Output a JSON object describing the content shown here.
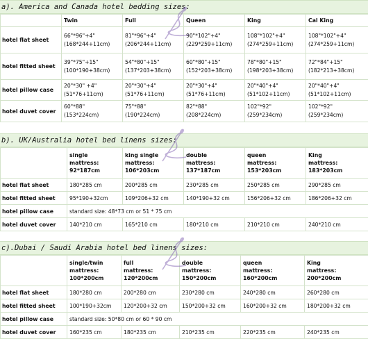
{
  "sections": [
    {
      "title": "a). America and Canada hotel bedding sizes:",
      "columns": [
        "",
        "Twin",
        "Full",
        "Queen",
        "King",
        "Cal King"
      ],
      "rows": [
        {
          "label": "hotel flat sheet",
          "cells": [
            {
              "l1": "66\"*96\"+4\"",
              "l2": "(168*244+11cm)"
            },
            {
              "l1": "81\"*96\"+4\"",
              "l2": "(206*244+11cm)"
            },
            {
              "l1": "90\"*102\"+4\"",
              "l2": "(229*259+11cm)"
            },
            {
              "l1": "108\"*102\"+4\"",
              "l2": "(274*259+11cm)"
            },
            {
              "l1": "108\"*102\"+4\"",
              "l2": "(274*259+11cm)"
            }
          ]
        },
        {
          "label": "hotel fitted sheet",
          "cells": [
            {
              "l1": "39\"*75\"+15\"",
              "l2": "(100*190+38cm)"
            },
            {
              "l1": "54\"*80\"+15\"",
              "l2": "(137*203+38cm)"
            },
            {
              "l1": "60\"*80\"+15\"",
              "l2": "(152*203+38cm)"
            },
            {
              "l1": "78\"*80\"+15\"",
              "l2": "(198*203+38cm)"
            },
            {
              "l1": "72\"*84\"+15\"",
              "l2": "(182*213+38cm)"
            }
          ]
        },
        {
          "label": "hotel pillow case",
          "cells": [
            {
              "l1": "20\"*30\" +4\"",
              "l2": "(51*76+11cm)"
            },
            {
              "l1": "20\"*30\"+4\"",
              "l2": "(51*76+11cm)"
            },
            {
              "l1": "20\"*30\"+4\"",
              "l2": "(51*76+11cm)"
            },
            {
              "l1": "20\"*40\"+4\"",
              "l2": "(51*102+11cm)"
            },
            {
              "l1": "20\"*40\"+4\"",
              "l2": "(51*102+11cm)"
            }
          ]
        },
        {
          "label": "hotel duvet cover",
          "cells": [
            {
              "l1": "60\"*88\"",
              "l2": "(153*224cm)"
            },
            {
              "l1": "75\"*88\"",
              "l2": "(190*224cm)"
            },
            {
              "l1": "82\"*88\"",
              "l2": "(208*224cm)"
            },
            {
              "l1": "102\"*92\"",
              "l2": "(259*234cm)"
            },
            {
              "l1": "102\"*92\"",
              "l2": "(259*234cm)"
            }
          ]
        }
      ]
    },
    {
      "title": "b). UK/Australia hotel bed linens sizes:",
      "columns": [
        {
          "a": "",
          "b": "",
          "c": ""
        },
        {
          "a": "single",
          "b": "mattress:",
          "c": "92*187cm"
        },
        {
          "a": "king single",
          "b": "mattress:",
          "c": "106*203cm"
        },
        {
          "a": "double",
          "b": "mattress:",
          "c": "137*187cm"
        },
        {
          "a": "queen",
          "b": "mattress:",
          "c": "153*203cm"
        },
        {
          "a": "King",
          "b": "mattress:",
          "c": "183*203cm"
        }
      ],
      "rows": [
        {
          "label": "hotel flat sheet",
          "cells": [
            "180*285 cm",
            "200*285 cm",
            "230*285 cm",
            "250*285 cm",
            "290*285 cm"
          ]
        },
        {
          "label": "hotel fitted sheet",
          "cells": [
            "95*190+32cm",
            "109*206+32 cm",
            "140*190+32 cm",
            "156*206+32 cm",
            "186*206+32 cm"
          ]
        },
        {
          "label": "hotel pillow case",
          "span": "standard size: 48*73 cm   or   51 * 75 cm"
        },
        {
          "label": "hotel duvet cover",
          "cells": [
            "140*210 cm",
            "165*210 cm",
            "180*210 cm",
            "210*210 cm",
            "240*210 cm"
          ]
        }
      ]
    },
    {
      "title": "c).Dubai / Saudi Arabia hotel bed linens sizes:",
      "columns": [
        {
          "a": "",
          "b": "",
          "c": ""
        },
        {
          "a": "single/twin",
          "b": "mattress:",
          "c": "100*200cm"
        },
        {
          "a": "full",
          "b": "mattress:",
          "c": "120*200cm"
        },
        {
          "a": "double",
          "b": "mattress:",
          "c": "150*200cm"
        },
        {
          "a": "queen",
          "b": "mattress:",
          "c": "160*200cm"
        },
        {
          "a": "King",
          "b": "mattress:",
          "c": "200*200cm"
        }
      ],
      "rows": [
        {
          "label": "hotel flat sheet",
          "cells": [
            "180*280 cm",
            "200*280 cm",
            "230*280 cm",
            "240*280 cm",
            "260*280 cm"
          ]
        },
        {
          "label": "hotel fitted sheet",
          "cells": [
            "100*190+32cm",
            "120*200+32 cm",
            "150*200+32 cm",
            "160*200+32 cm",
            "180*200+32 cm"
          ]
        },
        {
          "label": "hotel pillow case",
          "span": "standard size: 50*80 cm    or    60 * 90 cm"
        },
        {
          "label": "hotel duvet cover",
          "cells": [
            "160*235 cm",
            "180*235 cm",
            "210*235 cm",
            "220*235 cm",
            "240*235 cm"
          ]
        }
      ]
    }
  ],
  "colors": {
    "title_bg": "#e7f3df",
    "border": "#d4e3cb",
    "watermark": "#8b6fb8"
  },
  "watermark_icon": "needle-thread-logo"
}
